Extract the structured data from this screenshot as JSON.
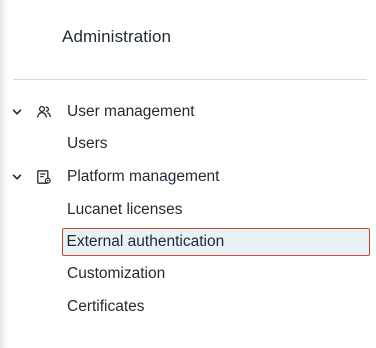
{
  "sidebar": {
    "title": "Administration",
    "groups": [
      {
        "label": "User management",
        "icon": "users-icon",
        "expanded": true,
        "items": [
          {
            "label": "Users",
            "selected": false
          }
        ]
      },
      {
        "label": "Platform management",
        "icon": "platform-settings-icon",
        "expanded": true,
        "items": [
          {
            "label": "Lucanet licenses",
            "selected": false
          },
          {
            "label": "External authentication",
            "selected": true
          },
          {
            "label": "Customization",
            "selected": false
          },
          {
            "label": "Certificates",
            "selected": false
          }
        ]
      }
    ]
  },
  "colors": {
    "text": "#1f2a33",
    "selected_background": "#e8f1f6",
    "selected_border": "#c94a2a",
    "divider": "#d5d8db"
  }
}
